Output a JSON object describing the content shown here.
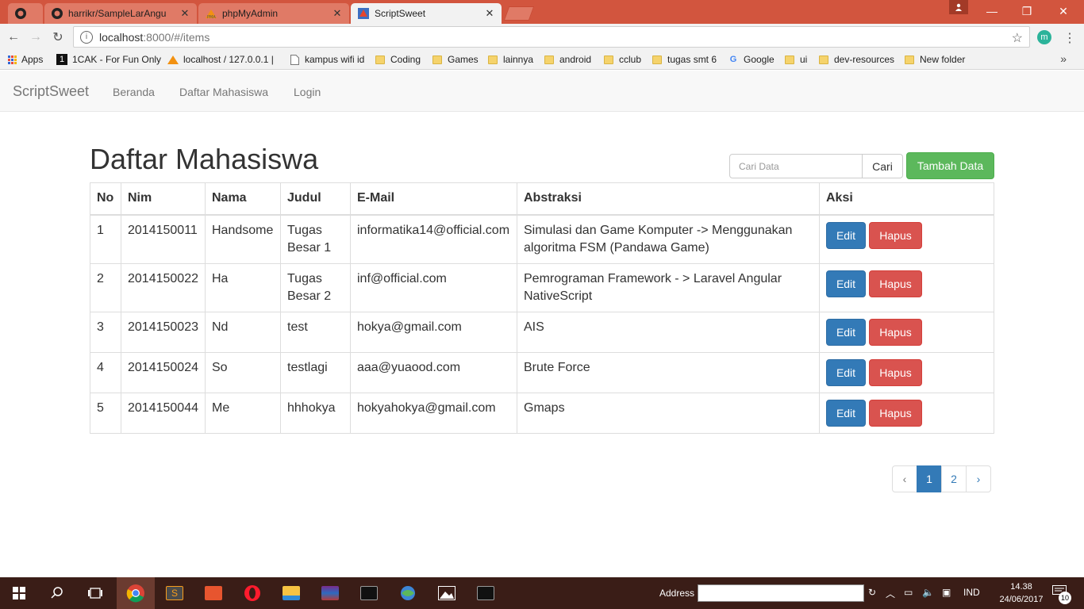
{
  "browser": {
    "tabs": [
      {
        "title": "",
        "icon": "github-icon"
      },
      {
        "title": "harrikr/SampleLarAngu",
        "icon": "github-icon"
      },
      {
        "title": "phpMyAdmin",
        "icon": "phpmyadmin-icon"
      },
      {
        "title": "ScriptSweet",
        "icon": "scriptsweet-icon",
        "active": true
      }
    ],
    "url_host": "localhost",
    "url_rest": ":8000/#/items",
    "extension_label": "m",
    "bookmarks": [
      {
        "label": "Apps",
        "icon": "apps-grid-icon"
      },
      {
        "label": "1CAK - For Fun Only",
        "icon": "onecak-icon"
      },
      {
        "label": "localhost / 127.0.0.1 |",
        "icon": "phpmyadmin-icon"
      },
      {
        "label": "kampus wifi id",
        "icon": "page-icon"
      },
      {
        "label": "Coding",
        "icon": "folder-icon"
      },
      {
        "label": "Games",
        "icon": "folder-icon"
      },
      {
        "label": "lainnya",
        "icon": "folder-icon"
      },
      {
        "label": "android",
        "icon": "folder-icon"
      },
      {
        "label": "cclub",
        "icon": "folder-icon"
      },
      {
        "label": "tugas smt 6",
        "icon": "folder-icon"
      },
      {
        "label": "Google",
        "icon": "google-icon"
      },
      {
        "label": "ui",
        "icon": "folder-icon"
      },
      {
        "label": "dev-resources",
        "icon": "folder-icon"
      },
      {
        "label": "New folder",
        "icon": "folder-icon"
      }
    ]
  },
  "navbar": {
    "brand": "ScriptSweet",
    "links": [
      "Beranda",
      "Daftar Mahasiswa",
      "Login"
    ]
  },
  "main": {
    "title": "Daftar Mahasiswa",
    "search_placeholder": "Cari Data",
    "search_button": "Cari",
    "add_button": "Tambah Data",
    "columns": [
      "No",
      "Nim",
      "Nama",
      "Judul",
      "E-Mail",
      "Abstraksi",
      "Aksi"
    ],
    "rows": [
      {
        "no": "1",
        "nim": "2014150011",
        "nama": "Handsome",
        "judul": "Tugas Besar 1",
        "email": "informatika14@official.com",
        "abstraksi": "Simulasi dan Game Komputer -> Menggunakan algoritma FSM (Pandawa Game)"
      },
      {
        "no": "2",
        "nim": "2014150022",
        "nama": "Ha",
        "judul": "Tugas Besar 2",
        "email": "inf@official.com",
        "abstraksi": "Pemrograman Framework - > Laravel Angular NativeScript"
      },
      {
        "no": "3",
        "nim": "2014150023",
        "nama": "Nd",
        "judul": "test",
        "email": "hokya@gmail.com",
        "abstraksi": "AIS"
      },
      {
        "no": "4",
        "nim": "2014150024",
        "nama": "So",
        "judul": "testlagi",
        "email": "aaa@yuaood.com",
        "abstraksi": "Brute Force"
      },
      {
        "no": "5",
        "nim": "2014150044",
        "nama": "Me",
        "judul": "hhhokya",
        "email": "hokyahokya@gmail.com",
        "abstraksi": "Gmaps"
      }
    ],
    "edit_label": "Edit",
    "delete_label": "Hapus",
    "pagination": {
      "prev": "‹",
      "pages": [
        "1",
        "2"
      ],
      "current": "1",
      "next": "›"
    }
  },
  "taskbar": {
    "address_label": "Address",
    "language": "IND",
    "time": "14.38",
    "date": "24/06/2017",
    "notification_count": "10"
  }
}
